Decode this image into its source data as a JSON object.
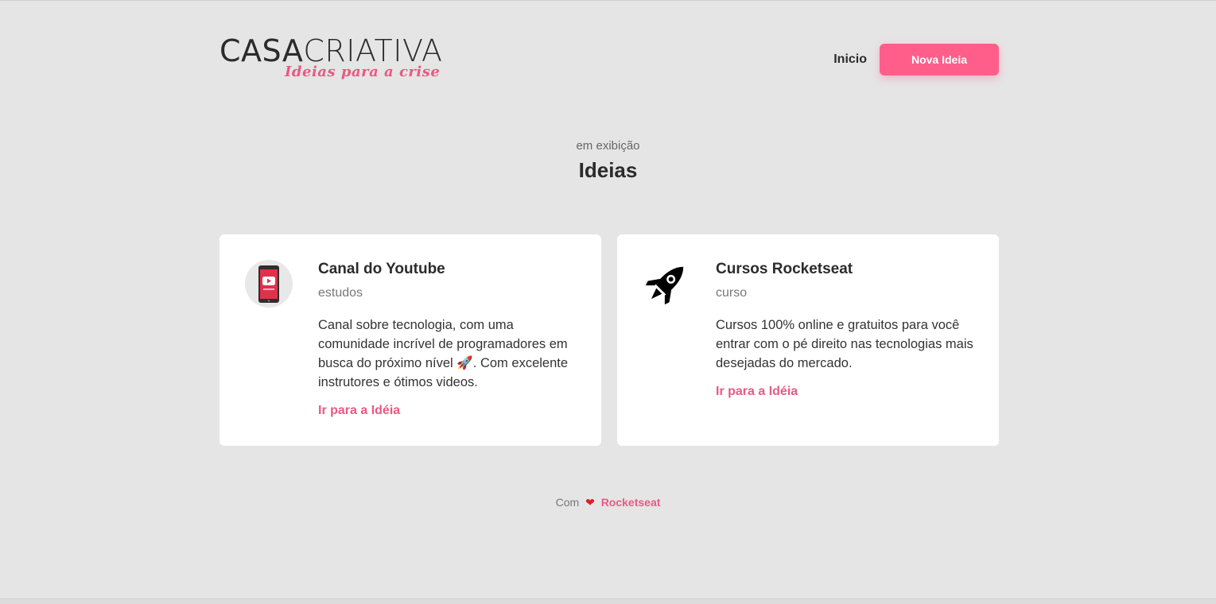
{
  "header": {
    "logo": {
      "main_bold": "CASA",
      "main_light": "CRIATIVA",
      "tagline": "Ideias para a crise"
    },
    "nav": {
      "home_label": "Inicio",
      "new_idea_label": "Nova Ideia"
    }
  },
  "section": {
    "pretitle": "em exibição",
    "title": "Ideias"
  },
  "ideas": [
    {
      "icon": "youtube-phone-icon",
      "title": "Canal do Youtube",
      "category": "estudos",
      "description": "Canal sobre tecnologia, com uma comunidade incrível de programadores em busca do próximo nível 🚀. Com excelente instrutores e ótimos videos.",
      "link_label": "Ir para a Idéia"
    },
    {
      "icon": "rocket-icon",
      "title": "Cursos Rocketseat",
      "category": "curso",
      "description": "Cursos 100% online e gratuitos para você entrar com o pé direito nas tecnologias mais desejadas do mercado.",
      "link_label": "Ir para a Idéia"
    }
  ],
  "footer": {
    "prefix": "Com",
    "heart": "❤",
    "brand": "Rocketseat"
  },
  "colors": {
    "background": "#e5e5e5",
    "accent": "#ff5e8b",
    "link": "#e85a83",
    "card": "#ffffff",
    "text": "#2b2b2b"
  }
}
